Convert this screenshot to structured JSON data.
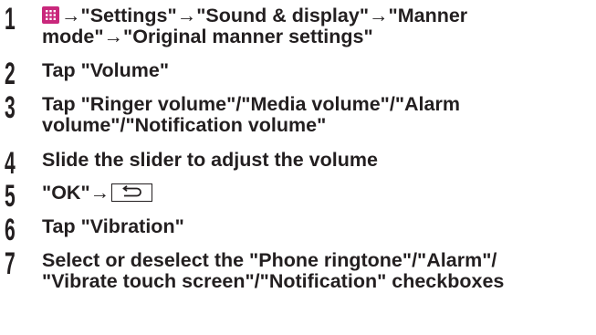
{
  "steps": [
    {
      "number": "1",
      "icon": "menu-grid-icon",
      "line1": "→\"Settings\"→\"Sound & display\"→\"Manner",
      "line2": "mode\"→\"Original manner settings\""
    },
    {
      "number": "2",
      "line1": "Tap \"Volume\""
    },
    {
      "number": "3",
      "line1": "Tap \"Ringer volume\"/\"Media volume\"/\"Alarm",
      "line2": "volume\"/\"Notification volume\""
    },
    {
      "number": "4",
      "line1": "Slide the slider to adjust the volume"
    },
    {
      "number": "5",
      "line1": "\"OK\"→",
      "icon": "back-key-icon"
    },
    {
      "number": "6",
      "line1": "Tap \"Vibration\""
    },
    {
      "number": "7",
      "line1": "Select or deselect the \"Phone ringtone\"/\"Alarm\"/",
      "line2": "\"Vibrate touch screen\"/\"Notification\" checkboxes"
    }
  ],
  "colors": {
    "text": "#231f20",
    "menu_icon": "#c9287c"
  }
}
